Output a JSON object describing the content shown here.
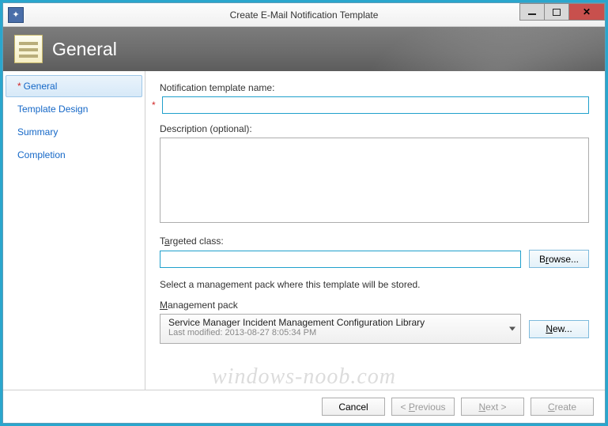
{
  "window": {
    "title": "Create E-Mail Notification Template"
  },
  "banner": {
    "title": "General"
  },
  "sidebar": {
    "items": [
      {
        "label": "General",
        "required": true,
        "selected": true
      },
      {
        "label": "Template Design",
        "required": false,
        "selected": false
      },
      {
        "label": "Summary",
        "required": false,
        "selected": false
      },
      {
        "label": "Completion",
        "required": false,
        "selected": false
      }
    ]
  },
  "form": {
    "name_label": "Notification template name:",
    "name_value": "",
    "desc_label": "Description (optional):",
    "desc_value": "",
    "target_label_pre": "T",
    "target_label_u": "a",
    "target_label_post": "rgeted class:",
    "target_value": "",
    "browse_pre": "B",
    "browse_u": "r",
    "browse_post": "owse...",
    "storage_helper": "Select a management pack where this template will be stored.",
    "mp_label_u": "M",
    "mp_label_post": "anagement pack",
    "mp_value": "Service Manager Incident Management Configuration Library",
    "mp_modified_label": "Last modified:",
    "mp_modified_value": "2013-08-27 8:05:34 PM",
    "new_u": "N",
    "new_post": "ew..."
  },
  "footer": {
    "cancel": "Cancel",
    "prev_pre": "< ",
    "prev_u": "P",
    "prev_post": "revious",
    "next_u": "N",
    "next_post": "ext >",
    "create_u": "C",
    "create_post": "reate"
  },
  "watermark": "windows-noob.com"
}
